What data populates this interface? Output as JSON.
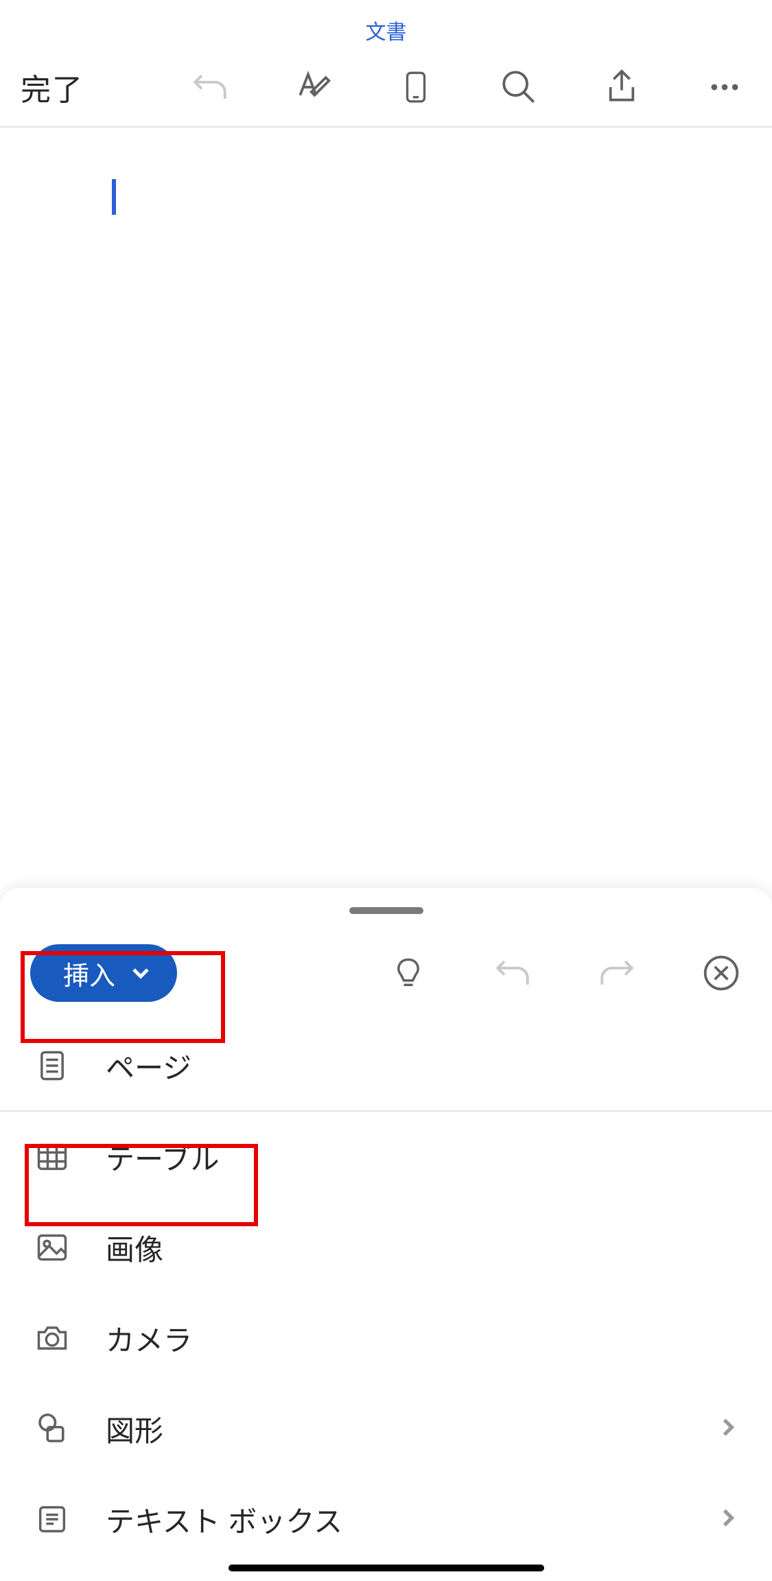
{
  "title": "文書",
  "toolbar": {
    "done": "完了"
  },
  "panel": {
    "insert_label": "挿入",
    "items": [
      {
        "label": "ページ",
        "chevron": false
      },
      {
        "label": "テーブル",
        "chevron": false
      },
      {
        "label": "画像",
        "chevron": false
      },
      {
        "label": "カメラ",
        "chevron": false
      },
      {
        "label": "図形",
        "chevron": true
      },
      {
        "label": "テキスト ボックス",
        "chevron": true
      }
    ]
  }
}
